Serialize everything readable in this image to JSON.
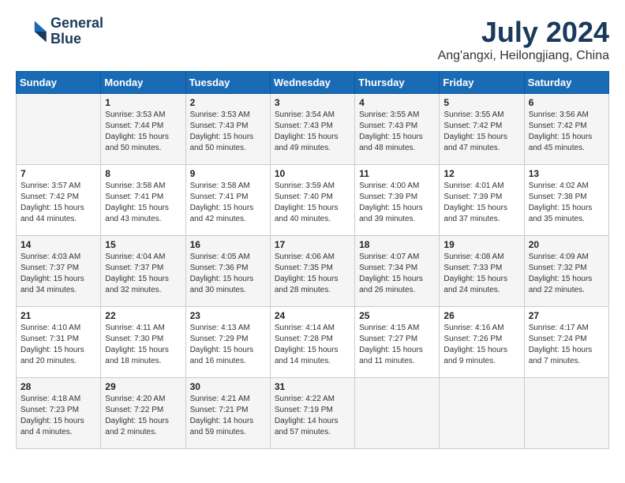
{
  "header": {
    "logo_line1": "General",
    "logo_line2": "Blue",
    "month_year": "July 2024",
    "location": "Ang'angxi, Heilongjiang, China"
  },
  "days_of_week": [
    "Sunday",
    "Monday",
    "Tuesday",
    "Wednesday",
    "Thursday",
    "Friday",
    "Saturday"
  ],
  "weeks": [
    [
      {
        "day": "",
        "content": ""
      },
      {
        "day": "1",
        "content": "Sunrise: 3:53 AM\nSunset: 7:44 PM\nDaylight: 15 hours\nand 50 minutes."
      },
      {
        "day": "2",
        "content": "Sunrise: 3:53 AM\nSunset: 7:43 PM\nDaylight: 15 hours\nand 50 minutes."
      },
      {
        "day": "3",
        "content": "Sunrise: 3:54 AM\nSunset: 7:43 PM\nDaylight: 15 hours\nand 49 minutes."
      },
      {
        "day": "4",
        "content": "Sunrise: 3:55 AM\nSunset: 7:43 PM\nDaylight: 15 hours\nand 48 minutes."
      },
      {
        "day": "5",
        "content": "Sunrise: 3:55 AM\nSunset: 7:42 PM\nDaylight: 15 hours\nand 47 minutes."
      },
      {
        "day": "6",
        "content": "Sunrise: 3:56 AM\nSunset: 7:42 PM\nDaylight: 15 hours\nand 45 minutes."
      }
    ],
    [
      {
        "day": "7",
        "content": "Sunrise: 3:57 AM\nSunset: 7:42 PM\nDaylight: 15 hours\nand 44 minutes."
      },
      {
        "day": "8",
        "content": "Sunrise: 3:58 AM\nSunset: 7:41 PM\nDaylight: 15 hours\nand 43 minutes."
      },
      {
        "day": "9",
        "content": "Sunrise: 3:58 AM\nSunset: 7:41 PM\nDaylight: 15 hours\nand 42 minutes."
      },
      {
        "day": "10",
        "content": "Sunrise: 3:59 AM\nSunset: 7:40 PM\nDaylight: 15 hours\nand 40 minutes."
      },
      {
        "day": "11",
        "content": "Sunrise: 4:00 AM\nSunset: 7:39 PM\nDaylight: 15 hours\nand 39 minutes."
      },
      {
        "day": "12",
        "content": "Sunrise: 4:01 AM\nSunset: 7:39 PM\nDaylight: 15 hours\nand 37 minutes."
      },
      {
        "day": "13",
        "content": "Sunrise: 4:02 AM\nSunset: 7:38 PM\nDaylight: 15 hours\nand 35 minutes."
      }
    ],
    [
      {
        "day": "14",
        "content": "Sunrise: 4:03 AM\nSunset: 7:37 PM\nDaylight: 15 hours\nand 34 minutes."
      },
      {
        "day": "15",
        "content": "Sunrise: 4:04 AM\nSunset: 7:37 PM\nDaylight: 15 hours\nand 32 minutes."
      },
      {
        "day": "16",
        "content": "Sunrise: 4:05 AM\nSunset: 7:36 PM\nDaylight: 15 hours\nand 30 minutes."
      },
      {
        "day": "17",
        "content": "Sunrise: 4:06 AM\nSunset: 7:35 PM\nDaylight: 15 hours\nand 28 minutes."
      },
      {
        "day": "18",
        "content": "Sunrise: 4:07 AM\nSunset: 7:34 PM\nDaylight: 15 hours\nand 26 minutes."
      },
      {
        "day": "19",
        "content": "Sunrise: 4:08 AM\nSunset: 7:33 PM\nDaylight: 15 hours\nand 24 minutes."
      },
      {
        "day": "20",
        "content": "Sunrise: 4:09 AM\nSunset: 7:32 PM\nDaylight: 15 hours\nand 22 minutes."
      }
    ],
    [
      {
        "day": "21",
        "content": "Sunrise: 4:10 AM\nSunset: 7:31 PM\nDaylight: 15 hours\nand 20 minutes."
      },
      {
        "day": "22",
        "content": "Sunrise: 4:11 AM\nSunset: 7:30 PM\nDaylight: 15 hours\nand 18 minutes."
      },
      {
        "day": "23",
        "content": "Sunrise: 4:13 AM\nSunset: 7:29 PM\nDaylight: 15 hours\nand 16 minutes."
      },
      {
        "day": "24",
        "content": "Sunrise: 4:14 AM\nSunset: 7:28 PM\nDaylight: 15 hours\nand 14 minutes."
      },
      {
        "day": "25",
        "content": "Sunrise: 4:15 AM\nSunset: 7:27 PM\nDaylight: 15 hours\nand 11 minutes."
      },
      {
        "day": "26",
        "content": "Sunrise: 4:16 AM\nSunset: 7:26 PM\nDaylight: 15 hours\nand 9 minutes."
      },
      {
        "day": "27",
        "content": "Sunrise: 4:17 AM\nSunset: 7:24 PM\nDaylight: 15 hours\nand 7 minutes."
      }
    ],
    [
      {
        "day": "28",
        "content": "Sunrise: 4:18 AM\nSunset: 7:23 PM\nDaylight: 15 hours\nand 4 minutes."
      },
      {
        "day": "29",
        "content": "Sunrise: 4:20 AM\nSunset: 7:22 PM\nDaylight: 15 hours\nand 2 minutes."
      },
      {
        "day": "30",
        "content": "Sunrise: 4:21 AM\nSunset: 7:21 PM\nDaylight: 14 hours\nand 59 minutes."
      },
      {
        "day": "31",
        "content": "Sunrise: 4:22 AM\nSunset: 7:19 PM\nDaylight: 14 hours\nand 57 minutes."
      },
      {
        "day": "",
        "content": ""
      },
      {
        "day": "",
        "content": ""
      },
      {
        "day": "",
        "content": ""
      }
    ]
  ]
}
